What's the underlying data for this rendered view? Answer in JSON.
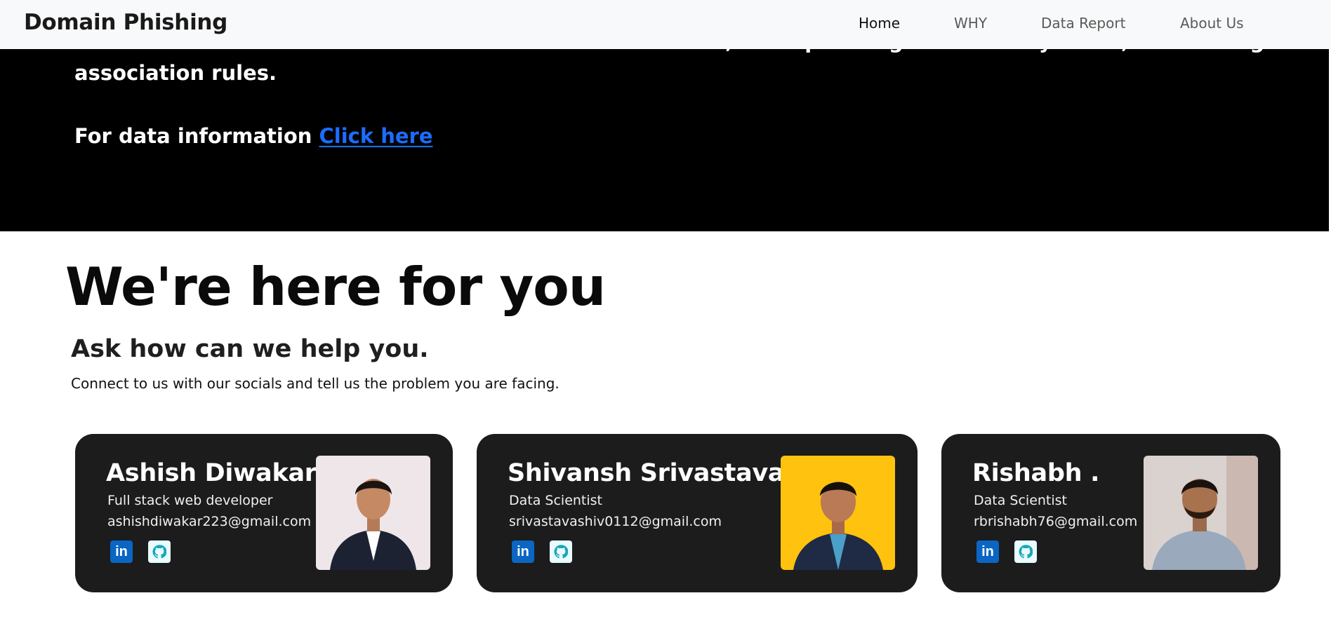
{
  "nav": {
    "brand": "Domain Phishing",
    "items": [
      {
        "label": "Home",
        "active": true
      },
      {
        "label": "WHY",
        "active": false
      },
      {
        "label": "Data Report",
        "active": false
      },
      {
        "label": "About Us",
        "active": false
      }
    ]
  },
  "hero": {
    "line2": "association rules.",
    "info_prefix": "For data information ",
    "link_label": "Click here",
    "link_color": "#1b6dff"
  },
  "contact": {
    "title": "We're here for you",
    "subtitle": "Ask how can we help you.",
    "description": "Connect to us with our socials and tell us the problem you are facing."
  },
  "team": [
    {
      "name": "Ashish Diwakar",
      "role": "Full stack web developer",
      "email": "ashishdiwakar223@gmail.com",
      "photo_bg": "#efe6ea"
    },
    {
      "name": "Shivansh Srivastava",
      "role": "Data Scientist",
      "email": "srivastavashiv0112@gmail.com",
      "photo_bg": "#ffc20e"
    },
    {
      "name": "Rishabh .",
      "role": "Data Scientist",
      "email": "rbrishabh76@gmail.com",
      "photo_bg": "#d9d2cf"
    }
  ],
  "icons": {
    "linkedin": "linkedin-icon",
    "github": "github-icon"
  }
}
